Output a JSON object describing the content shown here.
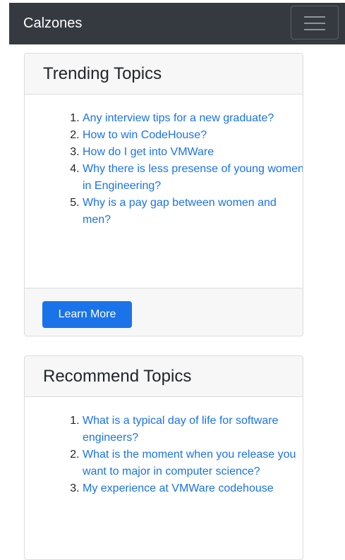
{
  "navbar": {
    "brand": "Calzones",
    "toggler_icon": "hamburger-menu-icon"
  },
  "cards": [
    {
      "title": "Trending Topics",
      "topics": [
        "Any interview tips for a new graduate?",
        "How to win CodeHouse?",
        "How do I get into VMWare",
        "Why there is less presense of young women in Engineering?",
        "Why is a pay gap between women and men?"
      ],
      "button_label": "Learn More"
    },
    {
      "title": "Recommend Topics",
      "topics": [
        "What is a typical day of life for software engineers?",
        "What is the moment when you release you want to major in computer science?",
        "My experience at VMWare codehouse"
      ]
    }
  ],
  "colors": {
    "navbar_bg": "#343a40",
    "link": "#1a73e8",
    "button_bg": "#1a73e8",
    "card_header_bg": "#f7f7f7"
  }
}
